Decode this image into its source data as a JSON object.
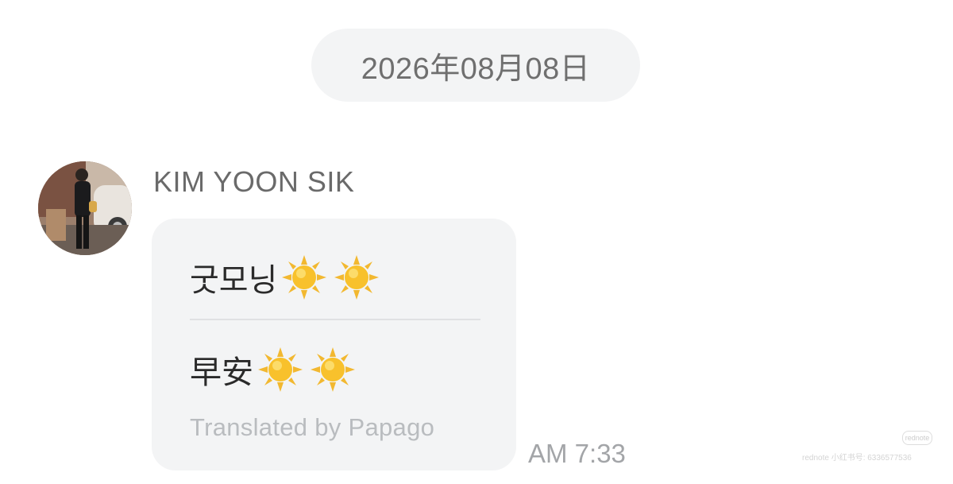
{
  "date_separator": "2026年08月08日",
  "sender": {
    "name": "KIM YOON SIK"
  },
  "message": {
    "original_text": "굿모닝",
    "original_emoji": [
      "sun-emoji",
      "sun-emoji"
    ],
    "translated_text": "早安",
    "translated_emoji": [
      "sun-emoji",
      "sun-emoji"
    ],
    "translation_credit": "Translated by Papago",
    "time": "AM 7:33"
  },
  "watermark": {
    "logo": "rednote",
    "text": "rednote 小红书号: 6336577536"
  },
  "colors": {
    "bubble": "#f3f4f5",
    "date_pill": "#f3f4f5",
    "text_primary": "#2a2a2a",
    "text_secondary": "#6a6a6a",
    "text_muted": "#b9bcbf"
  }
}
